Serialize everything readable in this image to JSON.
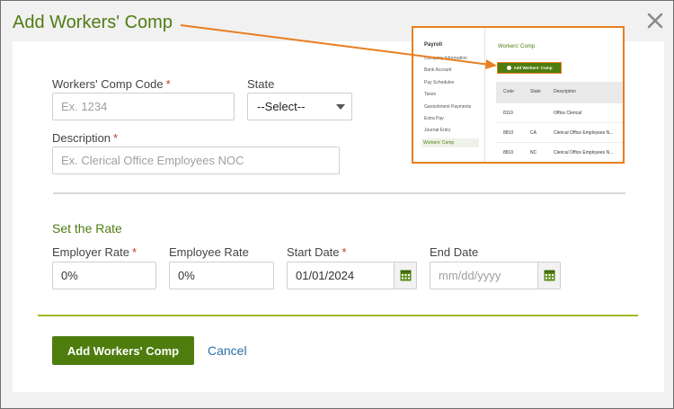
{
  "modal": {
    "title": "Add Workers' Comp"
  },
  "form": {
    "code_label": "Workers' Comp Code",
    "code_placeholder": "Ex. 1234",
    "state_label": "State",
    "state_value": "--Select--",
    "description_label": "Description",
    "description_placeholder": "Ex. Clerical Office Employees NOC",
    "required_marker": "*"
  },
  "rate": {
    "section_title": "Set the Rate",
    "employer_rate_label": "Employer Rate",
    "employer_rate_value": "0%",
    "employee_rate_label": "Employee Rate",
    "employee_rate_value": "0%",
    "start_date_label": "Start Date",
    "start_date_value": "01/01/2024",
    "end_date_label": "End Date",
    "end_date_placeholder": "mm/dd/yyyy"
  },
  "actions": {
    "submit_label": "Add Workers' Comp",
    "cancel_label": "Cancel"
  },
  "inset": {
    "sidebar_title": "Payroll",
    "sidebar_items": [
      "Company Information",
      "Bank Account",
      "Pay Schedules",
      "Taxes",
      "Garnishment Payments",
      "Extra Pay",
      "Journal Entry",
      "Workers' Comp"
    ],
    "page_title": "Workers' Comp",
    "add_button_label": "Add Workers' Comp",
    "columns": [
      "Code",
      "State",
      "Description"
    ],
    "rows": [
      {
        "code": "8110",
        "state": "",
        "description": "Office Clerical"
      },
      {
        "code": "8810",
        "state": "CA",
        "description": "Clerical Office Employees N..."
      },
      {
        "code": "8810",
        "state": "NC",
        "description": "Clerical Office Employees N..."
      }
    ]
  },
  "colors": {
    "brand_green": "#4e7d0e",
    "callout_orange": "#e87e1f",
    "link_blue": "#2a6fa8"
  },
  "icons": [
    "close-icon",
    "calendar-icon",
    "chevron-down-icon",
    "plus-circle-icon"
  ]
}
